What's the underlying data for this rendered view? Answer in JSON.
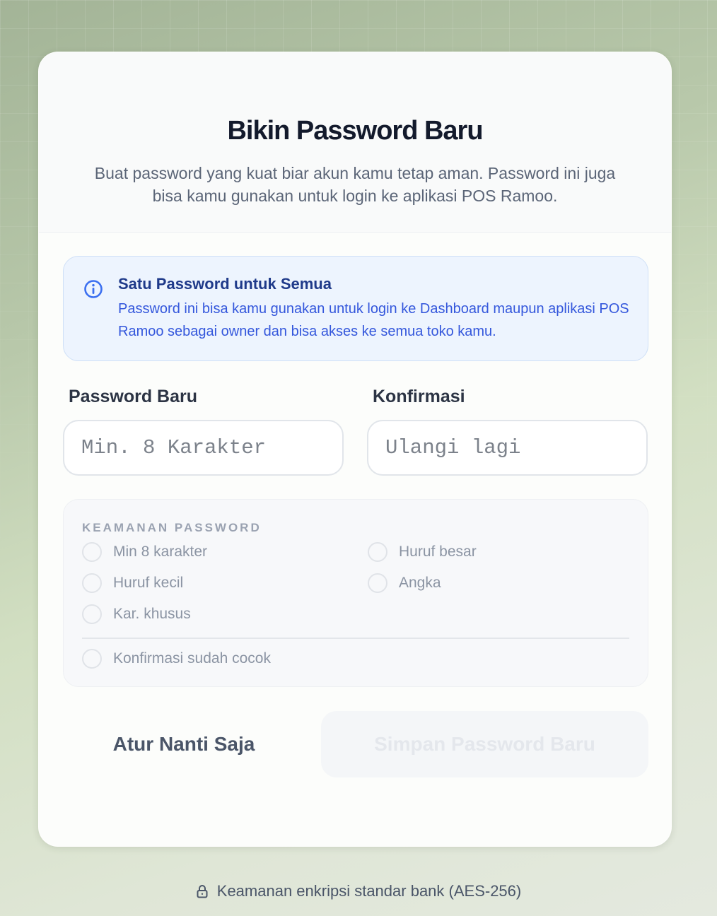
{
  "header": {
    "title": "Bikin Password Baru",
    "subtitle": "Buat password yang kuat biar akun kamu tetap aman. Password ini juga bisa kamu gunakan untuk login ke aplikasi POS Ramoo."
  },
  "info": {
    "icon": "info-icon",
    "title": "Satu Password untuk Semua",
    "text": "Password ini bisa kamu gunakan untuk login ke Dashboard maupun aplikasi POS Ramoo sebagai owner dan bisa akses ke semua toko kamu."
  },
  "form": {
    "password_label": "Password Baru",
    "password_placeholder": "Min. 8 Karakter",
    "password_value": "",
    "confirm_label": "Konfirmasi",
    "confirm_placeholder": "Ulangi lagi",
    "confirm_value": ""
  },
  "security": {
    "title": "KEAMANAN PASSWORD",
    "items": [
      {
        "label": "Min 8 karakter",
        "checked": false
      },
      {
        "label": "Huruf besar",
        "checked": false
      },
      {
        "label": "Huruf kecil",
        "checked": false
      },
      {
        "label": "Angka",
        "checked": false
      },
      {
        "label": "Kar. khusus",
        "checked": false
      }
    ],
    "match_label": "Konfirmasi sudah cocok",
    "match_checked": false
  },
  "actions": {
    "later_label": "Atur Nanti Saja",
    "save_label": "Simpan Password Baru"
  },
  "footer": {
    "icon": "lock-icon",
    "text": "Keamanan enkripsi standar bank (AES-256)"
  },
  "colors": {
    "info_accent": "#3457dc",
    "title": "#131a2c",
    "disabled_button_text": "#e4e7ec"
  }
}
